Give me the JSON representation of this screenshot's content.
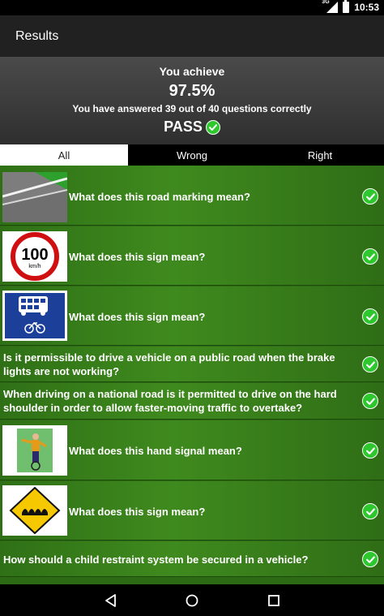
{
  "status_bar": {
    "time": "10:53",
    "signal_label": "3G",
    "icons": [
      "signal-icon",
      "battery-icon"
    ]
  },
  "app_bar": {
    "title": "Results"
  },
  "summary": {
    "achieve_label": "You achieve",
    "percent": "97.5%",
    "answered_text": "You have answered 39 out of 40 questions correctly",
    "result": "PASS",
    "result_icon": "check-circle-icon"
  },
  "tabs": [
    {
      "label": "All",
      "active": true
    },
    {
      "label": "Wrong",
      "active": false
    },
    {
      "label": "Right",
      "active": false
    }
  ],
  "questions": [
    {
      "text": "What does this road marking mean?",
      "image": "road-marking-image",
      "correct": true
    },
    {
      "text": "What does this sign mean?",
      "image": "speed-limit-100-sign",
      "sign_text": "100",
      "sign_unit": "km/h",
      "correct": true
    },
    {
      "text": "What does this sign mean?",
      "image": "bus-lane-sign",
      "correct": true
    },
    {
      "text": "Is it permissible to drive a vehicle on a public road when the brake lights are not working?",
      "image": null,
      "correct": true
    },
    {
      "text": "When driving on a national road is it permitted to drive on the hard shoulder in order to allow faster-moving traffic to overtake?",
      "image": null,
      "correct": true
    },
    {
      "text": "What does this hand signal mean?",
      "image": "cyclist-hand-signal-image",
      "correct": true
    },
    {
      "text": "What does this sign mean?",
      "image": "uneven-road-warning-sign",
      "correct": true
    },
    {
      "text": "How should a child restraint system be secured in a vehicle?",
      "image": null,
      "correct": true
    }
  ],
  "colors": {
    "accent_green": "#2ec72e",
    "list_green": "#3f8a1e",
    "header_dark": "#212121"
  },
  "nav_bar": {
    "buttons": [
      "back-icon",
      "home-icon",
      "recents-icon"
    ]
  }
}
